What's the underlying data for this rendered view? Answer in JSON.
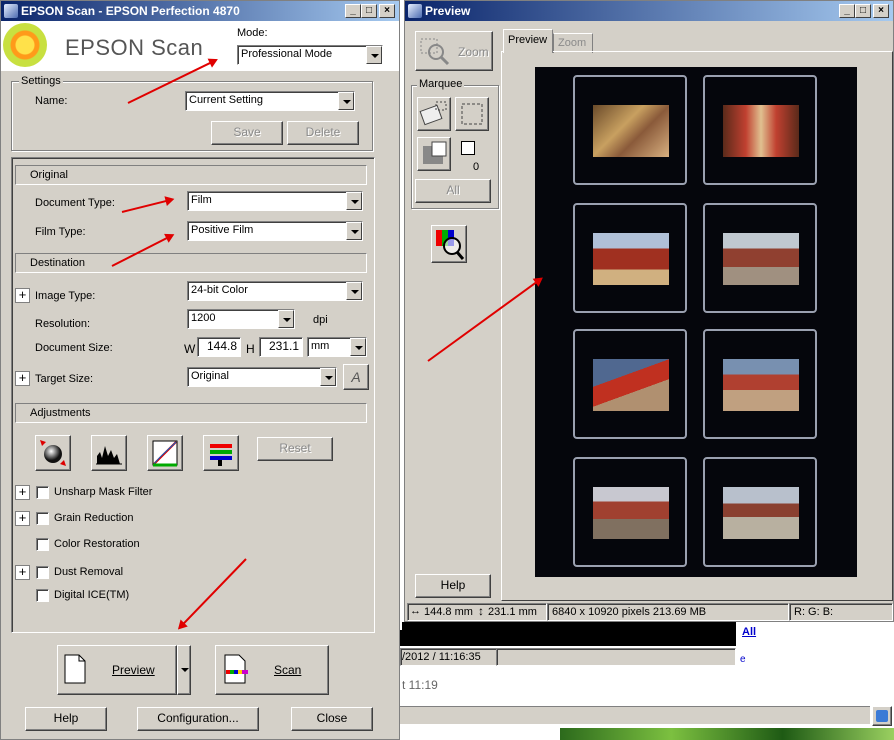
{
  "main_window": {
    "title": "EPSON Scan - EPSON Perfection 4870",
    "logo_text": "EPSON Scan",
    "mode_label": "Mode:",
    "mode_value": "Professional Mode",
    "settings_group": "Settings",
    "name_label": "Name:",
    "name_value": "Current Setting",
    "save_label": "Save",
    "delete_label": "Delete",
    "original_section": "Original",
    "document_type_label": "Document Type:",
    "document_type_value": "Film",
    "film_type_label": "Film Type:",
    "film_type_value": "Positive Film",
    "destination_section": "Destination",
    "image_type_label": "Image Type:",
    "image_type_value": "24-bit Color",
    "resolution_label": "Resolution:",
    "resolution_value": "1200",
    "resolution_unit": "dpi",
    "document_size_label": "Document Size:",
    "width_prefix": "W",
    "width_value": "144.8",
    "height_prefix": "H",
    "height_value": "231.1",
    "size_unit": "mm",
    "target_size_label": "Target Size:",
    "target_size_value": "Original",
    "adjustments_section": "Adjustments",
    "reset_label": "Reset",
    "unsharp_label": "Unsharp Mask Filter",
    "grain_label": "Grain Reduction",
    "color_restoration_label": "Color Restoration",
    "dust_label": "Dust Removal",
    "ice_label": "Digital ICE(TM)",
    "preview_label": "Preview",
    "scan_label": "Scan",
    "help_label": "Help",
    "configuration_label": "Configuration...",
    "close_label": "Close"
  },
  "preview_window": {
    "title": "Preview",
    "zoom_button": "Zoom",
    "marquee_group": "Marquee",
    "marquee_count": "0",
    "all_label": "All",
    "help_label": "Help",
    "tabs": [
      {
        "label": "Preview",
        "active": true
      },
      {
        "label": "Zoom",
        "active": false
      }
    ],
    "status_size_w": "144.8 mm",
    "status_size_h": "231.1 mm",
    "status_pixels": "6840 x 10920 pixels 213.69 MB",
    "status_rgb": "R: G: B:"
  },
  "background": {
    "link_text": "All",
    "timestamp": "/2012 / 11:16:35",
    "small_e": "e",
    "time_text": "t 11:19"
  },
  "colors": {
    "title_start": "#0a246a",
    "title_end": "#a6caf0",
    "face": "#d4d0c8",
    "arrow": "#e00000",
    "film_bg": "#05060c"
  }
}
